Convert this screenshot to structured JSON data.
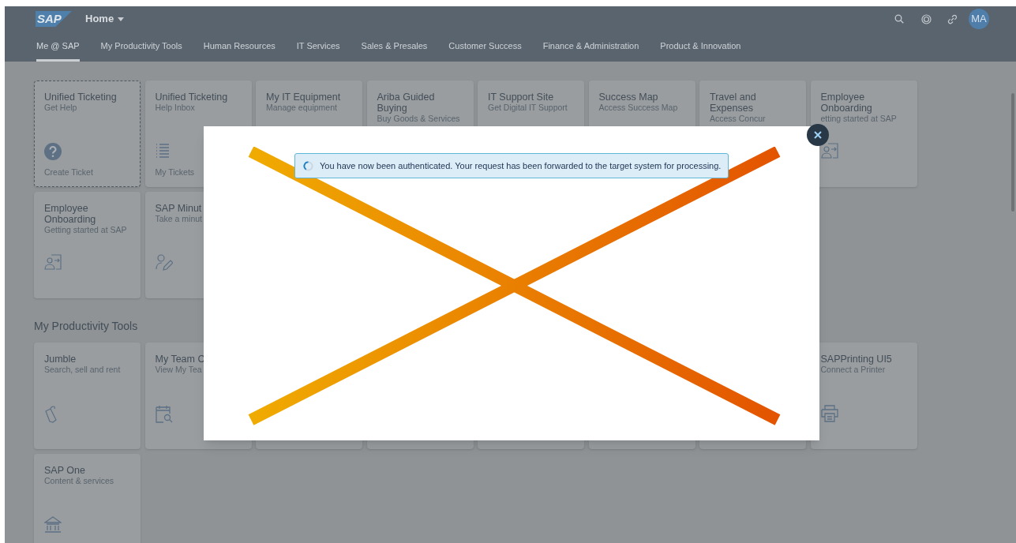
{
  "shell": {
    "logo": "SAP",
    "title": "Home",
    "avatar": "MA",
    "tabs": [
      {
        "label": "Me @ SAP",
        "selected": true
      },
      {
        "label": "My Productivity Tools",
        "selected": false
      },
      {
        "label": "Human Resources",
        "selected": false
      },
      {
        "label": "IT Services",
        "selected": false
      },
      {
        "label": "Sales & Presales",
        "selected": false
      },
      {
        "label": "Customer Success",
        "selected": false
      },
      {
        "label": "Finance & Administration",
        "selected": false
      },
      {
        "label": "Product & Innovation",
        "selected": false
      }
    ]
  },
  "groups": [
    {
      "rows": [
        [
          {
            "title": "Unified Ticketing",
            "subtitle": "Get Help",
            "footer": "Create Ticket",
            "kind": "help",
            "focused": true
          },
          {
            "title": "Unified Ticketing",
            "subtitle": "Help Inbox",
            "footer": "My Tickets",
            "kind": "list",
            "focused": false
          },
          {
            "title": "My IT Equipment",
            "subtitle": "Manage equipment",
            "focused": false
          },
          {
            "title": "Ariba Guided Buying",
            "subtitle": "Buy Goods & Services",
            "focused": false
          },
          {
            "title": "IT Support Site",
            "subtitle": "Get Digital IT Support",
            "focused": false
          },
          {
            "title": "Success Map",
            "subtitle": "Access Success Map",
            "focused": false
          },
          {
            "title": "Travel and Expenses",
            "subtitle": "Access Concur",
            "focused": false
          },
          {
            "title": "Employee Onboarding",
            "subtitle": "etting started at SAP",
            "kind": "onboarding",
            "focused": false
          }
        ],
        [
          {
            "title": "Employee Onboarding",
            "subtitle": "Getting started at SAP",
            "kind": "onboarding",
            "focused": false
          },
          {
            "title": "SAP Minut",
            "subtitle": "Take a minut",
            "kind": "edit",
            "focused": false
          }
        ]
      ]
    },
    {
      "title": "My Productivity Tools",
      "rows": [
        [
          {
            "title": "Jumble",
            "subtitle": "Search, sell and rent",
            "kind": "tag",
            "focused": false
          },
          {
            "title": "My Team C",
            "subtitle": "View My Tea",
            "kind": "calendar",
            "focused": false
          },
          {
            "focused": false
          },
          {
            "focused": false
          },
          {
            "focused": false
          },
          {
            "focused": false
          },
          {
            "focused": false
          },
          {
            "title": "SAPPrinting UI5",
            "subtitle": "Connect a Printer",
            "kind": "printer",
            "focused": false
          }
        ],
        [
          {
            "title": "SAP One",
            "subtitle": "Content & services",
            "kind": "building",
            "focused": false
          }
        ]
      ]
    }
  ],
  "dialog": {
    "message": "You have now been authenticated. Your request has been forwarded to the target system for processing."
  }
}
